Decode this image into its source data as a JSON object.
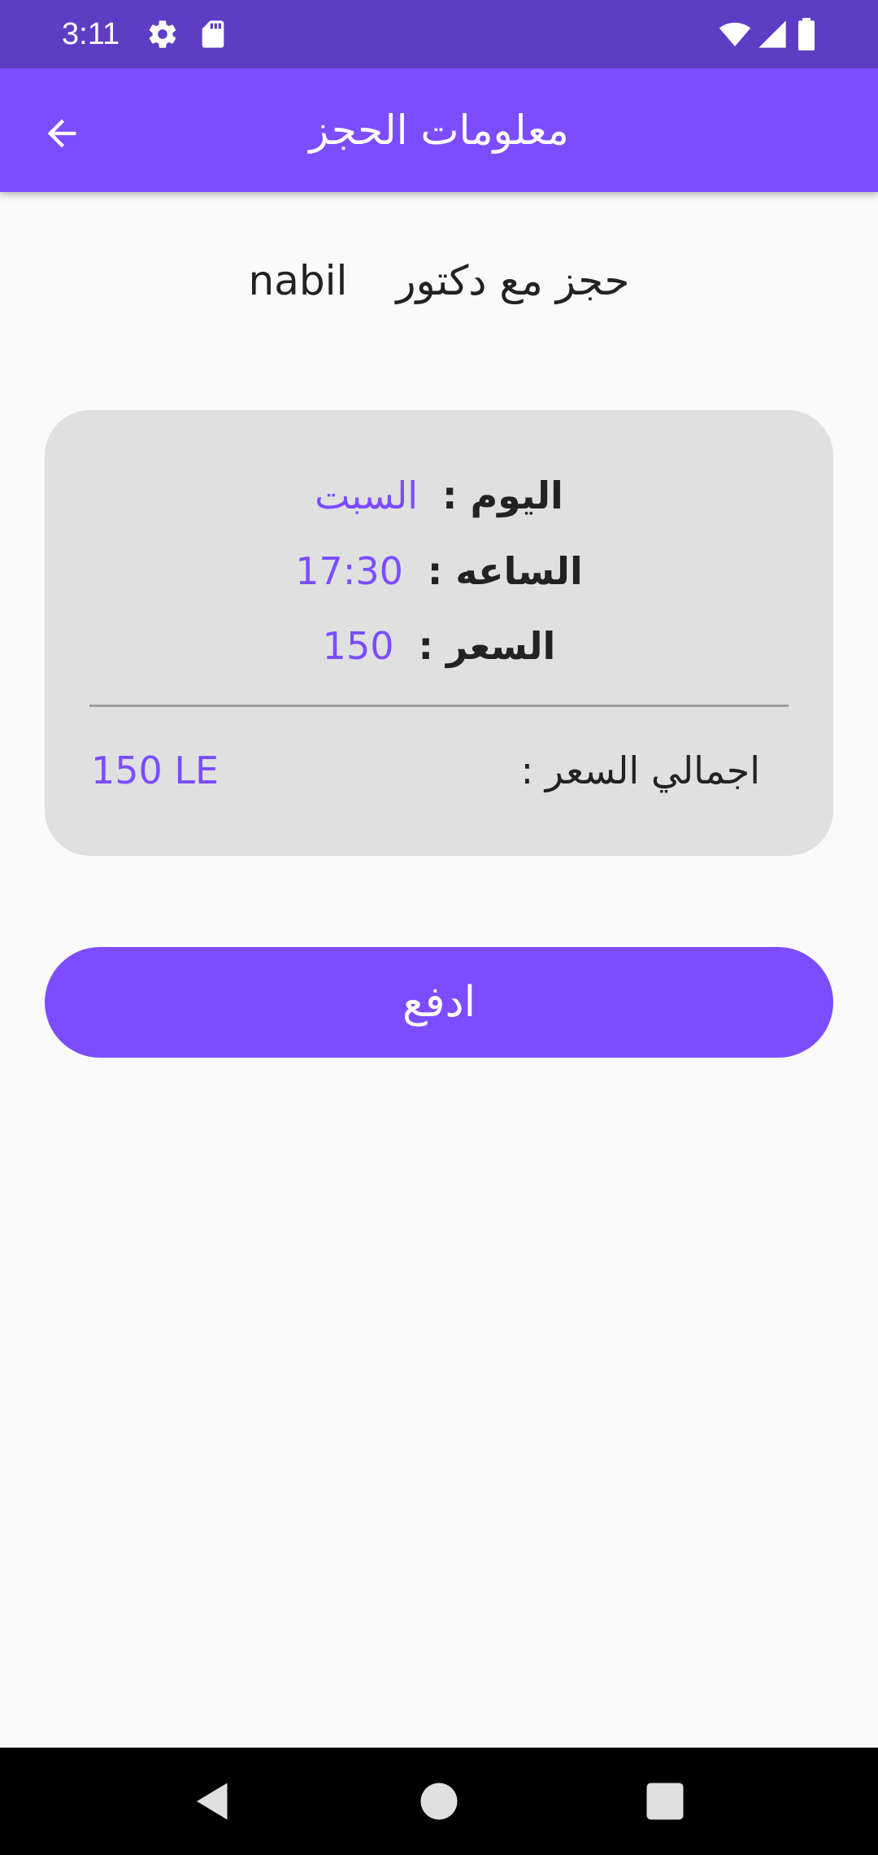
{
  "status_bar": {
    "time": "3:11",
    "icons": [
      "settings-icon",
      "sd-card-icon",
      "wifi-icon",
      "signal-icon",
      "battery-icon"
    ],
    "color": "#5e3dc4"
  },
  "app_bar": {
    "title": "معلومات الحجز",
    "back_icon": "arrow-back-icon",
    "color": "#7c4dff"
  },
  "heading": {
    "prefix": "حجز مع دكتور",
    "doctor_name": "nabil"
  },
  "booking": {
    "day_label": "اليوم :",
    "day_value": "السبت",
    "time_label": "الساعه :",
    "time_value": "17:30",
    "price_label": "السعر :",
    "price_value": "150",
    "total_label": "اجمالي السعر :",
    "total_value": "150 LE",
    "accent_color": "#7c4dff"
  },
  "pay_button": {
    "label": "ادفع"
  },
  "nav_bar": {
    "icons": [
      "back-triangle-icon",
      "home-circle-icon",
      "recents-square-icon"
    ]
  }
}
